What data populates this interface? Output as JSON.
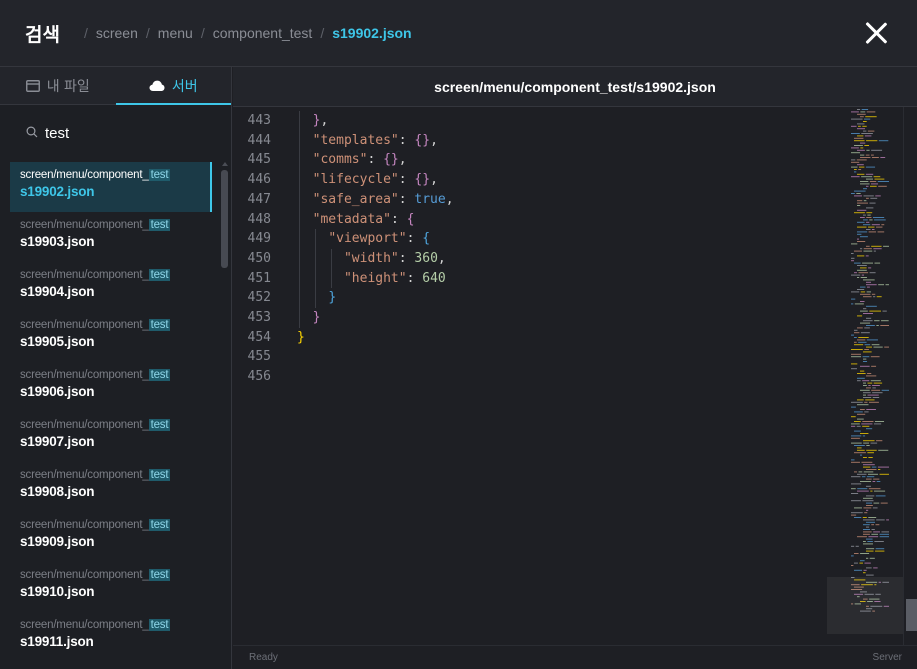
{
  "header": {
    "title": "검색",
    "breadcrumbs": [
      "screen",
      "menu",
      "component_test",
      "s19902.json"
    ]
  },
  "sidebar": {
    "tabs": [
      {
        "label": "내 파일",
        "icon": "window-icon",
        "active": false
      },
      {
        "label": "서버",
        "icon": "cloud-icon",
        "active": true
      }
    ],
    "search": {
      "value": "test",
      "placeholder": ""
    },
    "files": [
      {
        "path": "screen/menu/component_",
        "highlight": "test",
        "name": "s19902.json",
        "selected": true
      },
      {
        "path": "screen/menu/component_",
        "highlight": "test",
        "name": "s19903.json",
        "selected": false
      },
      {
        "path": "screen/menu/component_",
        "highlight": "test",
        "name": "s19904.json",
        "selected": false
      },
      {
        "path": "screen/menu/component_",
        "highlight": "test",
        "name": "s19905.json",
        "selected": false
      },
      {
        "path": "screen/menu/component_",
        "highlight": "test",
        "name": "s19906.json",
        "selected": false
      },
      {
        "path": "screen/menu/component_",
        "highlight": "test",
        "name": "s19907.json",
        "selected": false
      },
      {
        "path": "screen/menu/component_",
        "highlight": "test",
        "name": "s19908.json",
        "selected": false
      },
      {
        "path": "screen/menu/component_",
        "highlight": "test",
        "name": "s19909.json",
        "selected": false
      },
      {
        "path": "screen/menu/component_",
        "highlight": "test",
        "name": "s19910.json",
        "selected": false
      },
      {
        "path": "screen/menu/component_",
        "highlight": "test",
        "name": "s19911.json",
        "selected": false
      }
    ]
  },
  "editor": {
    "title": "screen/menu/component_test/s19902.json",
    "lines": [
      {
        "n": "443",
        "indent": 1,
        "tokens": [
          [
            "br2",
            "}"
          ],
          [
            "punc",
            ","
          ]
        ]
      },
      {
        "n": "444",
        "indent": 1,
        "tokens": [
          [
            "key",
            "\"templates\""
          ],
          [
            "punc",
            ": "
          ],
          [
            "obj",
            "{}"
          ],
          [
            "punc",
            ","
          ]
        ]
      },
      {
        "n": "445",
        "indent": 1,
        "tokens": [
          [
            "key",
            "\"comms\""
          ],
          [
            "punc",
            ": "
          ],
          [
            "obj",
            "{}"
          ],
          [
            "punc",
            ","
          ]
        ]
      },
      {
        "n": "446",
        "indent": 1,
        "tokens": [
          [
            "key",
            "\"lifecycle\""
          ],
          [
            "punc",
            ": "
          ],
          [
            "obj",
            "{}"
          ],
          [
            "punc",
            ","
          ]
        ]
      },
      {
        "n": "447",
        "indent": 1,
        "tokens": [
          [
            "key",
            "\"safe_area\""
          ],
          [
            "punc",
            ": "
          ],
          [
            "bool",
            "true"
          ],
          [
            "punc",
            ","
          ]
        ]
      },
      {
        "n": "448",
        "indent": 1,
        "tokens": [
          [
            "key",
            "\"metadata\""
          ],
          [
            "punc",
            ": "
          ],
          [
            "br2",
            "{"
          ]
        ]
      },
      {
        "n": "449",
        "indent": 2,
        "tokens": [
          [
            "key",
            "\"viewport\""
          ],
          [
            "punc",
            ": "
          ],
          [
            "br3",
            "{"
          ]
        ]
      },
      {
        "n": "450",
        "indent": 3,
        "tokens": [
          [
            "key",
            "\"width\""
          ],
          [
            "punc",
            ": "
          ],
          [
            "num",
            "360"
          ],
          [
            "punc",
            ","
          ]
        ]
      },
      {
        "n": "451",
        "indent": 3,
        "tokens": [
          [
            "key",
            "\"height\""
          ],
          [
            "punc",
            ": "
          ],
          [
            "num",
            "640"
          ]
        ]
      },
      {
        "n": "452",
        "indent": 2,
        "tokens": [
          [
            "br3",
            "}"
          ]
        ]
      },
      {
        "n": "453",
        "indent": 1,
        "tokens": [
          [
            "br2",
            "}"
          ]
        ]
      },
      {
        "n": "454",
        "indent": 0,
        "tokens": [
          [
            "br1",
            "}"
          ]
        ]
      },
      {
        "n": "455",
        "indent": 0,
        "tokens": []
      },
      {
        "n": "456",
        "indent": 0,
        "tokens": []
      }
    ]
  },
  "statusbar": {
    "left": "Ready",
    "right": "Server"
  }
}
